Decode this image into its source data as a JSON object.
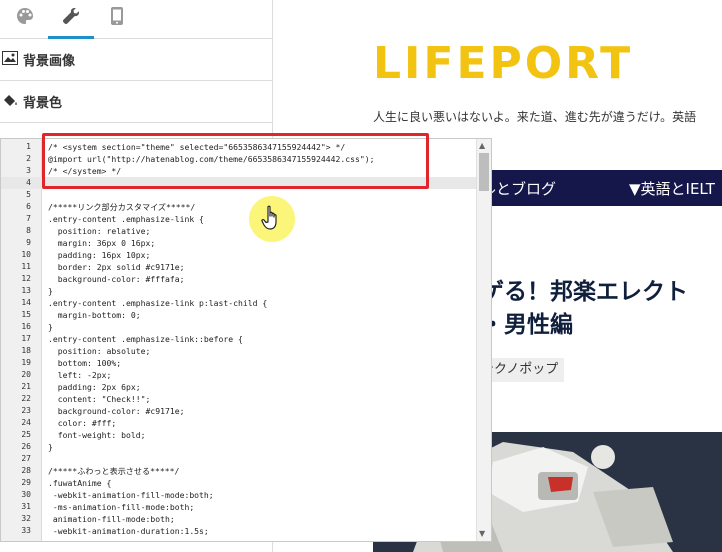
{
  "sidebar": {
    "tabs": [
      {
        "icon": "palette-icon"
      },
      {
        "icon": "wrench-icon",
        "active": true
      },
      {
        "icon": "mobile-icon"
      }
    ],
    "sections": [
      {
        "icon": "image-icon",
        "label": "背景画像"
      },
      {
        "icon": "paint-bucket-icon",
        "label": "背景色"
      }
    ]
  },
  "editor": {
    "lines": [
      {
        "n": "1",
        "code": "/* <system section=\"theme\" selected=\"6653586347155924442\"> */"
      },
      {
        "n": "2",
        "code": "@import url(\"http://hatenablog.com/theme/6653586347155924442.css\");"
      },
      {
        "n": "3",
        "code": "/* </system> */"
      },
      {
        "n": "4",
        "code": ""
      },
      {
        "n": "5",
        "code": ""
      },
      {
        "n": "6",
        "code": "/*****リンク部分カスタマイズ*****/"
      },
      {
        "n": "7",
        "code": ".entry-content .emphasize-link {"
      },
      {
        "n": "8",
        "code": "  position: relative;"
      },
      {
        "n": "9",
        "code": "  margin: 36px 0 16px;"
      },
      {
        "n": "10",
        "code": "  padding: 16px 10px;"
      },
      {
        "n": "11",
        "code": "  border: 2px solid #c9171e;"
      },
      {
        "n": "12",
        "code": "  background-color: #fffafa;"
      },
      {
        "n": "13",
        "code": "}"
      },
      {
        "n": "14",
        "code": ".entry-content .emphasize-link p:last-child {"
      },
      {
        "n": "15",
        "code": "  margin-bottom: 0;"
      },
      {
        "n": "16",
        "code": "}"
      },
      {
        "n": "17",
        "code": ".entry-content .emphasize-link::before {"
      },
      {
        "n": "18",
        "code": "  position: absolute;"
      },
      {
        "n": "19",
        "code": "  bottom: 100%;"
      },
      {
        "n": "20",
        "code": "  left: -2px;"
      },
      {
        "n": "21",
        "code": "  padding: 2px 6px;"
      },
      {
        "n": "22",
        "code": "  content: \"Check!!\";"
      },
      {
        "n": "23",
        "code": "  background-color: #c9171e;"
      },
      {
        "n": "24",
        "code": "  color: #fff;"
      },
      {
        "n": "25",
        "code": "  font-weight: bold;"
      },
      {
        "n": "26",
        "code": "}"
      },
      {
        "n": "27",
        "code": ""
      },
      {
        "n": "28",
        "code": "/*****ふわっと表示させる*****/"
      },
      {
        "n": "29",
        "code": ".fuwatAnime {"
      },
      {
        "n": "30",
        "code": " -webkit-animation-fill-mode:both;"
      },
      {
        "n": "31",
        "code": " -ms-animation-fill-mode:both;"
      },
      {
        "n": "32",
        "code": " animation-fill-mode:both;"
      },
      {
        "n": "33",
        "code": " -webkit-animation-duration:1.5s;"
      }
    ],
    "active_line": "4"
  },
  "preview": {
    "logo": "LIFEPORT",
    "tagline": "人生に良い悪いはないよ。来た道、進む先が違うだけ。英語",
    "nav": [
      "ルとブログ",
      "▼英語とIELT"
    ],
    "title_lines": [
      "ゲる！邦楽エレクト",
      "・男性編"
    ],
    "tag": "テクノポップ"
  },
  "colors": {
    "logo": "#f2c310",
    "nav_bg": "#15164a",
    "highlight_border": "#e0262a",
    "cursor_halo": "#fbf46a",
    "active_tab": "#1e90c8"
  }
}
